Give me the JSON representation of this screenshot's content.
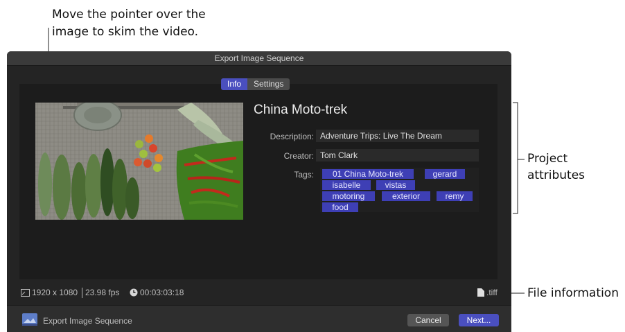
{
  "callouts": {
    "top_line1": "Move the pointer over the",
    "top_line2": "image to skim the video.",
    "project_line1": "Project",
    "project_line2": "attributes",
    "file_info": "File information"
  },
  "window": {
    "title": "Export Image Sequence"
  },
  "tabs": [
    {
      "label": "Info",
      "active": true
    },
    {
      "label": "Settings",
      "active": false
    }
  ],
  "project": {
    "title": "China Moto-trek",
    "description_label": "Description:",
    "description_value": "Adventure Trips: Live The Dream",
    "creator_label": "Creator:",
    "creator_value": "Tom Clark",
    "tags_label": "Tags:",
    "tags": [
      "01 China Moto-trek",
      "gerard",
      "isabelle",
      "vistas",
      "motoring",
      "exterior",
      "remy",
      "food"
    ]
  },
  "file_info": {
    "resolution": "1920 x 1080",
    "frame_rate": "23.98 fps",
    "duration": "00:03:03:18",
    "format": ".tiff"
  },
  "footer": {
    "label": "Export Image Sequence",
    "cancel_label": "Cancel",
    "next_label": "Next..."
  },
  "colors": {
    "accent": "#4a4fbf",
    "tag_bg": "#3e3fb5",
    "dialog_bg": "#242424"
  },
  "icons": [
    "frame-size-icon",
    "clock-icon",
    "document-icon",
    "export-image-sequence-icon"
  ]
}
